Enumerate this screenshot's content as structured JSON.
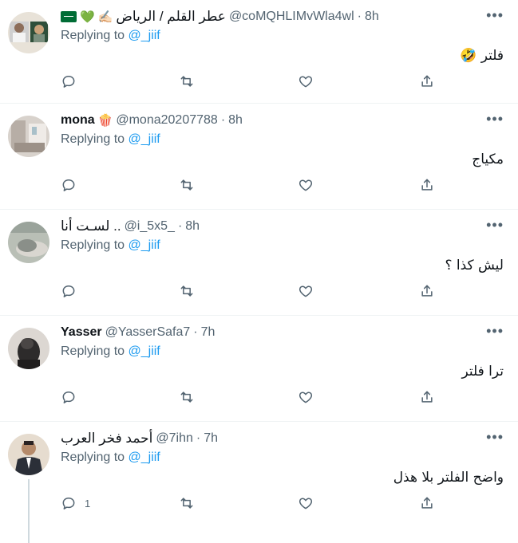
{
  "tweets": [
    {
      "name": "عطر القلم / الرياض",
      "emojis": [
        "✍🏻",
        "💚"
      ],
      "flag": true,
      "handle": "@coMQHLIMvWla4wl",
      "dot": "·",
      "time": "8h",
      "replying_prefix": "Replying to",
      "replying_to": "@_jiif",
      "text": "فلتر 🤣",
      "reply_count": "",
      "avatar_colors": [
        "#3a6b4a",
        "#e8e2d8"
      ]
    },
    {
      "name": "mona",
      "emojis": [
        "🍿"
      ],
      "flag": false,
      "handle": "@mona20207788",
      "dot": "·",
      "time": "8h",
      "replying_prefix": "Replying to",
      "replying_to": "@_jiif",
      "text": "مكياج",
      "reply_count": "",
      "avatar_colors": [
        "#c9c2bb",
        "#8a8079"
      ]
    },
    {
      "name": "لسـت أنا ..",
      "emojis": [],
      "flag": false,
      "handle": "@i_5x5_",
      "dot": "·",
      "time": "8h",
      "replying_prefix": "Replying to",
      "replying_to": "@_jiif",
      "text": "ليش كذا ؟",
      "reply_count": "",
      "avatar_colors": [
        "#a8b0a6",
        "#6e7670"
      ]
    },
    {
      "name": "Yasser",
      "emojis": [],
      "flag": false,
      "handle": "@YasserSafa7",
      "dot": "·",
      "time": "7h",
      "replying_prefix": "Replying to",
      "replying_to": "@_jiif",
      "text": "ترا فلتر",
      "reply_count": "",
      "avatar_colors": [
        "#d9d4cf",
        "#2c2a2a"
      ]
    },
    {
      "name": "أحمد فخر العرب",
      "emojis": [],
      "flag": false,
      "handle": "@7ihn",
      "dot": "·",
      "time": "7h",
      "replying_prefix": "Replying to",
      "replying_to": "@_jiif",
      "text": "واضح الفلتر بلا هذل",
      "reply_count": "1",
      "avatar_colors": [
        "#2b2f38",
        "#e6dccf"
      ]
    }
  ],
  "icons": {
    "reply": "reply-icon",
    "retweet": "retweet-icon",
    "like": "like-icon",
    "share": "share-icon",
    "more": "more-icon"
  },
  "colors": {
    "link": "#1d9bf0",
    "secondary": "#536471",
    "divider": "#eff3f4"
  }
}
